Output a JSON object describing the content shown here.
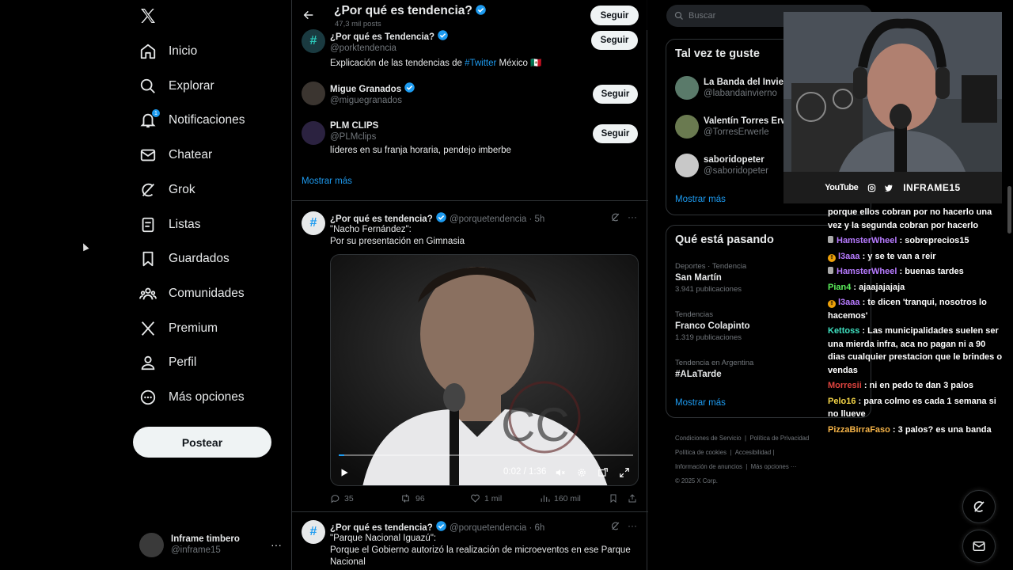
{
  "left_nav": {
    "items": [
      {
        "label": "Inicio",
        "icon": "home-icon"
      },
      {
        "label": "Explorar",
        "icon": "search-icon"
      },
      {
        "label": "Notificaciones",
        "icon": "bell-icon",
        "badge": "1"
      },
      {
        "label": "Chatear",
        "icon": "mail-icon"
      },
      {
        "label": "Grok",
        "icon": "grok-icon"
      },
      {
        "label": "Listas",
        "icon": "list-icon"
      },
      {
        "label": "Guardados",
        "icon": "bookmark-icon"
      },
      {
        "label": "Comunidades",
        "icon": "communities-icon"
      },
      {
        "label": "Premium",
        "icon": "x-icon"
      },
      {
        "label": "Perfil",
        "icon": "person-icon"
      },
      {
        "label": "Más opciones",
        "icon": "more-circle-icon"
      }
    ],
    "post_button": "Postear",
    "account": {
      "name": "Inframe timbero",
      "handle": "@inframe15",
      "more": "···"
    }
  },
  "header": {
    "title": "¿Por qué es tendencia?",
    "posts_count": "47,3 mil posts",
    "follow": "Seguir"
  },
  "suggested_accounts": [
    {
      "name": "¿Por qué es Tendencia?",
      "handle": "@porktendencia",
      "verified": true,
      "bio_prefix": "Explicación de las tendencias de ",
      "bio_link": "#Twitter",
      "bio_suffix": " México 🇲🇽",
      "follow": "Seguir"
    },
    {
      "name": "Migue Granados",
      "handle": "@miguegranados",
      "verified": true,
      "follow": "Seguir"
    },
    {
      "name": "PLM CLIPS",
      "handle": "@PLMclips",
      "verified": false,
      "bio": "líderes en su franja horaria, pendejo imberbe",
      "follow": "Seguir"
    }
  ],
  "show_more": "Mostrar más",
  "tweets": [
    {
      "author": "¿Por qué es tendencia?",
      "handle": "@porquetendencia",
      "time": "· 5h",
      "line1": "\"Nacho Fernández\":",
      "line2": "Por su presentación en Gimnasia",
      "video_time": "0:02 / 1:36",
      "video_progress": 0.02,
      "replies": "35",
      "retweets": "96",
      "likes": "1 mil",
      "views": "160 mil"
    },
    {
      "author": "¿Por qué es tendencia?",
      "handle": "@porquetendencia",
      "time": "· 6h",
      "line1": "\"Parque Nacional Iguazú\":",
      "line2": "Porque el Gobierno autorizó la realización de microeventos en ese Parque",
      "line3": "Nacional"
    }
  ],
  "right": {
    "search_placeholder": "Buscar",
    "may_like_title": "Tal vez te guste",
    "may_like": [
      {
        "name": "La Banda del Invier",
        "handle": "@labandainvierno"
      },
      {
        "name": "Valentín Torres Erw",
        "handle": "@TorresErwerle"
      },
      {
        "name": "saboridopeter",
        "handle": "@saboridopeter"
      }
    ],
    "may_like_more": "Mostrar más",
    "trending_title": "Qué está pasando",
    "trends": [
      {
        "category": "Deportes · Tendencia",
        "name": "San Martín",
        "count": "3.941 publicaciones"
      },
      {
        "category": "Tendencias",
        "name": "Franco Colapinto",
        "count": "1.319 publicaciones"
      },
      {
        "category": "Tendencia en Argentina",
        "name": "#ALaTarde",
        "count": ""
      }
    ],
    "trends_more": "Mostrar más",
    "footer": [
      "Condiciones de Servicio",
      "Política de Privacidad",
      "Política de cookies",
      "Accesibilidad",
      "Información de anuncios",
      "Más opciones ···",
      "© 2025 X Corp."
    ]
  },
  "stream": {
    "social": [
      "YouTube",
      "INFRAME15"
    ],
    "chat": [
      {
        "user": "",
        "text": "porque ellos cobran por no hacerlo una vez y la segunda cobran por hacerlo",
        "color": "#ffffff",
        "badge": ""
      },
      {
        "user": "HamsterWheel",
        "text": " : sobreprecios15",
        "color": "#b77bff",
        "badge": "snd"
      },
      {
        "user": "l3aaa",
        "text": " : y se te van a reir",
        "color": "#b77bff",
        "badge": "mod"
      },
      {
        "user": "HamsterWheel",
        "text": " : buenas tardes",
        "color": "#b77bff",
        "badge": "snd"
      },
      {
        "user": "Pian4",
        "text": " : ajaajajajaja",
        "color": "#5cf05c",
        "badge": ""
      },
      {
        "user": "l3aaa",
        "text": " : te dicen 'tranqui, nosotros lo hacemos'",
        "color": "#b77bff",
        "badge": "mod"
      },
      {
        "user": "Kettoss",
        "text": " : Las municipalidades suelen ser una mierda infra, aca no pagan ni a 90 dias cualquier prestacion que le brindes o vendas",
        "color": "#3fe0c0",
        "badge": ""
      },
      {
        "user": "Morresii",
        "text": " : ni en pedo te dan 3 palos",
        "color": "#e0443f",
        "badge": ""
      },
      {
        "user": "Pelo16",
        "text": " : para colmo es cada 1 semana si no llueve",
        "color": "#f5d547",
        "badge": ""
      },
      {
        "user": "PizzaBirraFaso",
        "text": " : 3 palos? es una banda",
        "color": "#f5b347",
        "badge": ""
      }
    ]
  },
  "colors": {
    "accent": "#1d9bf0",
    "background": "#000000",
    "border": "#2f3336",
    "muted": "#71767b"
  }
}
